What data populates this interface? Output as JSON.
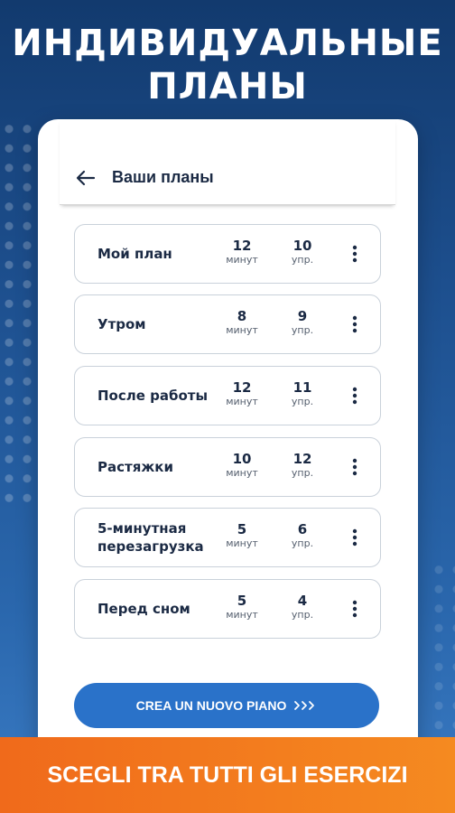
{
  "headline": {
    "line1": "ИНДИВИДУАЛЬНЫЕ",
    "line2": "ПЛАНЫ"
  },
  "header": {
    "title": "Ваши планы",
    "back_icon": "arrow-left-icon"
  },
  "plans": [
    {
      "name": "Мой план",
      "minutes": "12",
      "minutes_unit": "минут",
      "exercises": "10",
      "exercises_unit": "упр."
    },
    {
      "name": "Утром",
      "minutes": "8",
      "minutes_unit": "минут",
      "exercises": "9",
      "exercises_unit": "упр."
    },
    {
      "name": "После работы",
      "minutes": "12",
      "minutes_unit": "минут",
      "exercises": "11",
      "exercises_unit": "упр."
    },
    {
      "name": "Растяжки",
      "minutes": "10",
      "minutes_unit": "минут",
      "exercises": "12",
      "exercises_unit": "упр."
    },
    {
      "name": "5-минутная перезагрузка",
      "minutes": "5",
      "minutes_unit": "минут",
      "exercises": "6",
      "exercises_unit": "упр."
    },
    {
      "name": "Перед сном",
      "minutes": "5",
      "minutes_unit": "минут",
      "exercises": "4",
      "exercises_unit": "упр."
    }
  ],
  "cta": {
    "label": "CREA UN NUOVO PIANO",
    "icon": "triple-chevron-right-icon"
  },
  "banner": {
    "text": "SCEGLI TRA TUTTI GLI ESERCIZI"
  },
  "colors": {
    "accent": "#2a72c9",
    "banner": "#f27a1d",
    "text": "#1b2a44"
  }
}
